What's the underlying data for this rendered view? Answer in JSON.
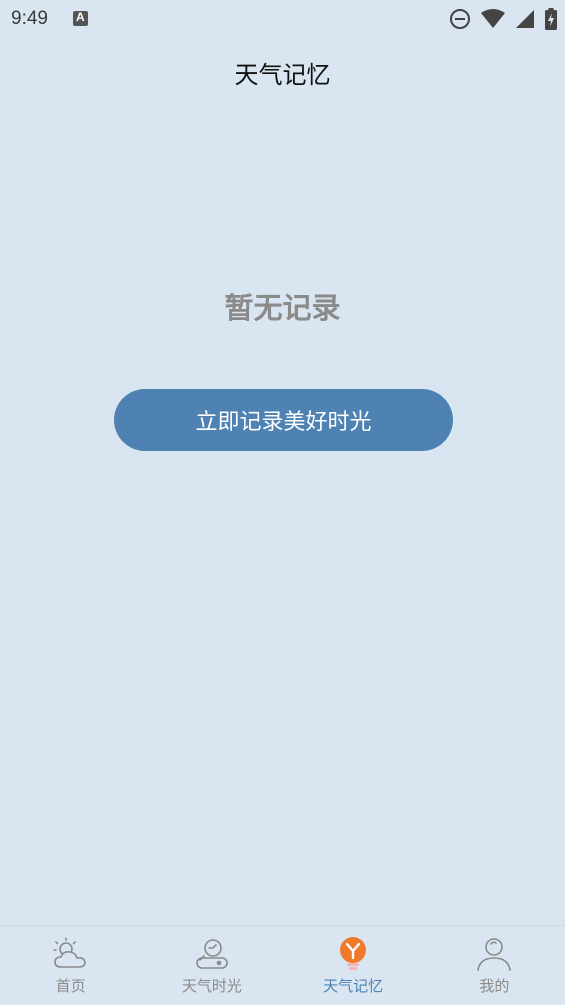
{
  "status_bar": {
    "time": "9:49",
    "notification_letter": "A"
  },
  "header": {
    "title": "天气记忆"
  },
  "main": {
    "empty_text": "暂无记录",
    "cta_label": "立即记录美好时光"
  },
  "tab_bar": {
    "tabs": [
      {
        "label": "首页",
        "icon": "weather-cloud-sun-icon",
        "active": false
      },
      {
        "label": "天气时光",
        "icon": "weather-time-icon",
        "active": false
      },
      {
        "label": "天气记忆",
        "icon": "lightbulb-icon",
        "active": true
      },
      {
        "label": "我的",
        "icon": "user-icon",
        "active": false
      }
    ]
  },
  "colors": {
    "background": "#d9e6f1",
    "accent": "#4d82b3",
    "active_icon": "#f07a2c",
    "inactive": "#8a8a8a"
  }
}
